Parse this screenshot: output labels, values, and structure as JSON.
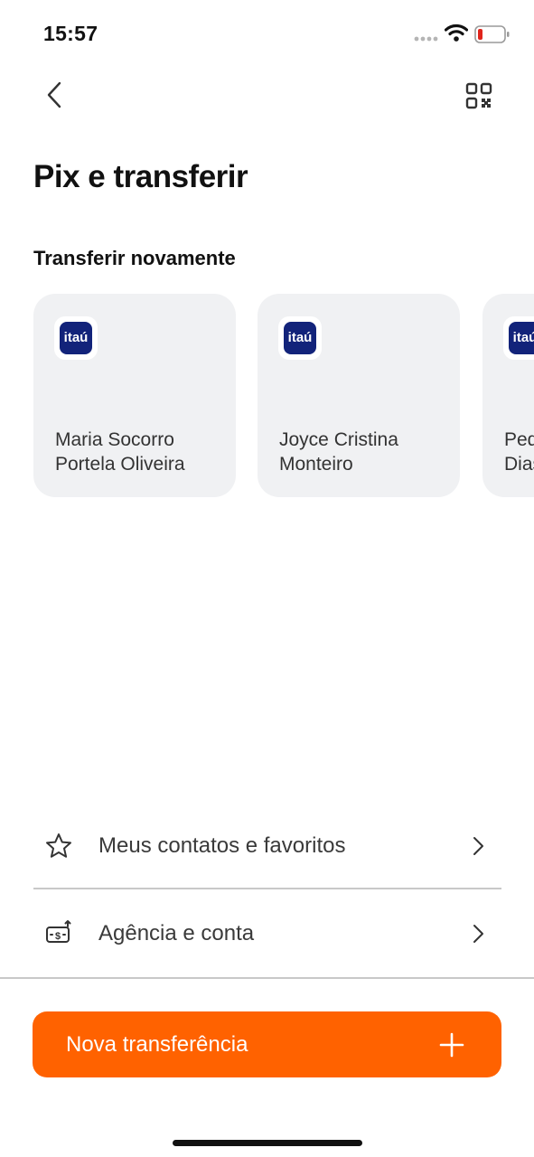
{
  "status_bar": {
    "time": "15:57",
    "icons": [
      "signal-icon",
      "wifi-icon",
      "battery-low-icon"
    ],
    "battery_color": "#e0241b"
  },
  "nav": {
    "back_icon": "chevron-left-icon",
    "qr_icon": "qr-code-icon"
  },
  "page": {
    "title": "Pix e transferir",
    "section_title": "Transferir novamente"
  },
  "recent_transfers": [
    {
      "bank": "itaú",
      "name": "Maria Socorro\nPortela Oliveira"
    },
    {
      "bank": "itaú",
      "name": "Joyce Cristina\nMonteiro"
    },
    {
      "bank": "itaú",
      "name": "Ped\nDias"
    }
  ],
  "menu": [
    {
      "icon": "star-icon",
      "label": "Meus contatos e favoritos"
    },
    {
      "icon": "bank-transfer-icon",
      "label": "Agência e conta"
    }
  ],
  "cta": {
    "label": "Nova transferência",
    "icon": "plus-icon",
    "color": "#ff6200"
  },
  "colors": {
    "bank_logo": "#12237a",
    "card_bg": "#f0f1f3"
  }
}
